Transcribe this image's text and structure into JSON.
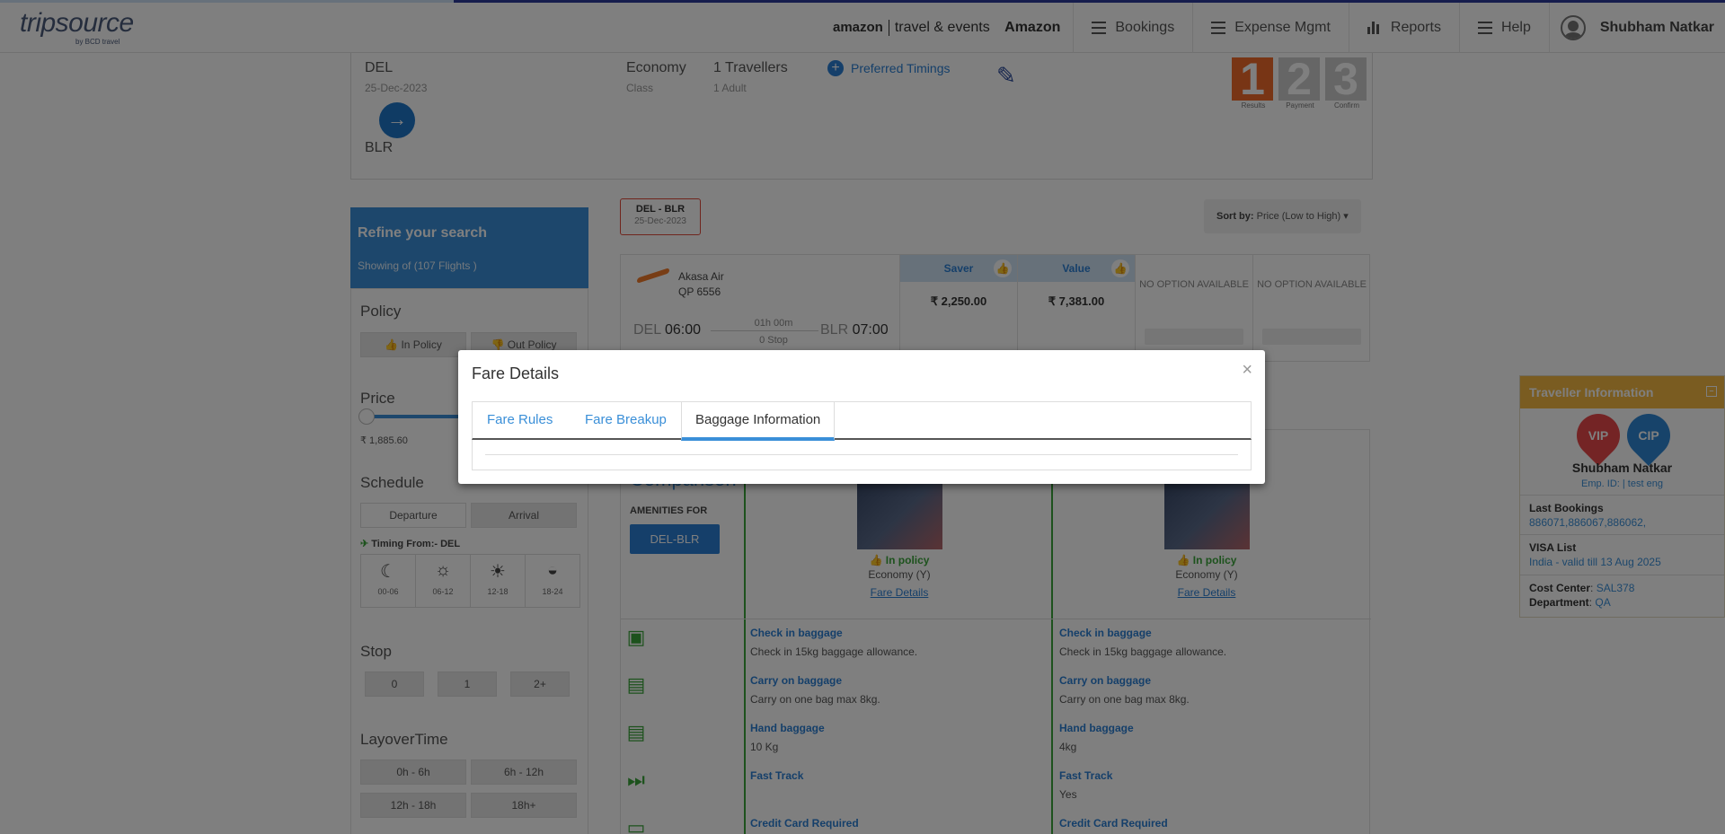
{
  "header": {
    "logo_main": "tripsource",
    "logo_sub": "by BCD travel",
    "brand_left": "amazon",
    "brand_right": "travel & events",
    "company": "Amazon",
    "nav": [
      {
        "label": "Bookings",
        "icon": "menu-icon"
      },
      {
        "label": "Expense Mgmt",
        "icon": "menu-icon"
      },
      {
        "label": "Reports",
        "icon": "bar-chart-icon"
      },
      {
        "label": "Help",
        "icon": "menu-icon"
      }
    ],
    "user_name": "Shubham Natkar"
  },
  "search": {
    "from_code": "DEL",
    "date": "25-Dec-2023",
    "to_code": "BLR",
    "class_value": "Economy",
    "class_label": "Class",
    "travellers_value": "1 Travellers",
    "travellers_label": "1 Adult",
    "preferred_timings": "Preferred Timings",
    "steps": [
      {
        "num": "1",
        "label": "Results"
      },
      {
        "num": "2",
        "label": "Payment"
      },
      {
        "num": "3",
        "label": "Confirm"
      }
    ]
  },
  "sidebar": {
    "title": "Refine your search",
    "subtitle": "Showing of (107 Flights )",
    "policy": "Policy",
    "in_policy": "In Policy",
    "out_policy": "Out Policy",
    "price": "Price",
    "price_min": "₹ 1,885.60",
    "schedule": "Schedule",
    "departure": "Departure",
    "arrival": "Arrival",
    "timing_from": "Timing From:- DEL",
    "time_slots": [
      "00-06",
      "06-12",
      "12-18",
      "18-24"
    ],
    "stop": "Stop",
    "stops": [
      "0",
      "1",
      "2+"
    ],
    "layover": "LayoverTime",
    "layovers": [
      "0h - 6h",
      "6h - 12h",
      "12h - 18h",
      "18h+"
    ]
  },
  "results": {
    "route_tab_route": "DEL  -  BLR",
    "route_tab_date": "25-Dec-2023",
    "sort_label": "Sort by:",
    "sort_value": "Price (Low to High)",
    "flight": {
      "airline": "Akasa Air",
      "flight_no": "QP  6556",
      "dep_code": "DEL",
      "dep_time": "06:00",
      "arr_code": "BLR",
      "arr_time": "07:00",
      "duration": "01h 00m",
      "stops": "0 Stop"
    },
    "fares": [
      {
        "name": "Saver",
        "amount": "₹ 2,250.00"
      },
      {
        "name": "Value",
        "amount": "₹ 7,381.00"
      }
    ],
    "no_option": "NO OPTION AVAILABLE"
  },
  "comparison": {
    "title": "Comparison",
    "amenities_for": "AMENITIES FOR",
    "route_btn": "DEL-BLR",
    "columns": [
      {
        "policy": "In policy",
        "cabin": "Economy (Y)",
        "fare_details": "Fare Details",
        "rows": [
          {
            "k": "Check in baggage",
            "v": "Check in 15kg baggage allowance."
          },
          {
            "k": "Carry on baggage",
            "v": "Carry on one bag max 8kg."
          },
          {
            "k": "Hand baggage",
            "v": "10 Kg"
          },
          {
            "k": "Fast Track",
            "v": ""
          },
          {
            "k": "Credit Card Required",
            "v": ""
          }
        ]
      },
      {
        "policy": "In policy",
        "cabin": "Economy (Y)",
        "fare_details": "Fare Details",
        "rows": [
          {
            "k": "Check in baggage",
            "v": "Check in 15kg baggage allowance."
          },
          {
            "k": "Carry on baggage",
            "v": "Carry on one bag max 8kg."
          },
          {
            "k": "Hand baggage",
            "v": "4kg"
          },
          {
            "k": "Fast Track",
            "v": "Yes"
          },
          {
            "k": "Credit Card Required",
            "v": ""
          }
        ]
      }
    ]
  },
  "traveller": {
    "title": "Traveller Information",
    "badge1": "VIP",
    "badge2": "CIP",
    "name": "Shubham Natkar",
    "emp_id": "Emp. ID: | test eng",
    "last_bookings_label": "Last Bookings",
    "last_bookings": "886071,886067,886062,",
    "visa_label": "VISA List",
    "visa_value": "India - valid till 13 Aug 2025",
    "cost_center_label": "Cost Center",
    "cost_center": "SAL378",
    "department_label": "Department",
    "department": "QA"
  },
  "modal": {
    "title": "Fare Details",
    "close": "×",
    "tabs": [
      "Fare Rules",
      "Fare Breakup",
      "Baggage Information"
    ],
    "active_tab": "Baggage Information"
  },
  "colors": {
    "accent": "#3a8fd8",
    "orange": "#f06b2a",
    "green": "#3aa53a",
    "traveller_header": "#f5b942"
  }
}
